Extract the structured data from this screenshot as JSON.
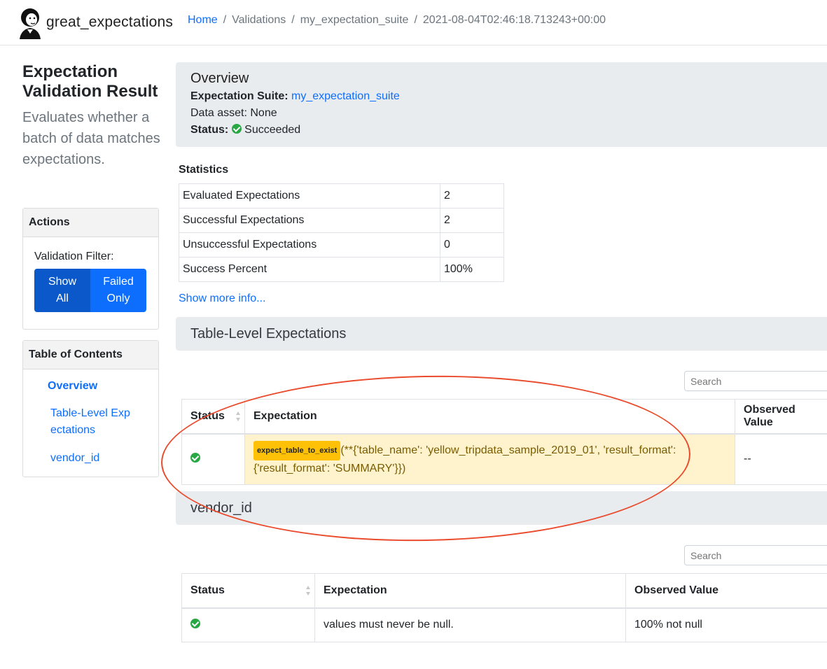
{
  "navbar": {
    "brand": "great_expectations",
    "breadcrumb": {
      "home": "Home",
      "validations": "Validations",
      "suite": "my_expectation_suite",
      "run": "2021-08-04T02:46:18.713243+00:00"
    }
  },
  "sidebar": {
    "title": "Expectation Validation Result",
    "description": "Evaluates whether a batch of data matches expectations.",
    "actions": {
      "header": "Actions",
      "filter_label": "Validation Filter:",
      "show_all": "Show All",
      "failed_only": "Failed Only"
    },
    "toc": {
      "header": "Table of Contents",
      "items": [
        "Overview",
        "Table-Level Exp ectations",
        "vendor_id"
      ]
    }
  },
  "overview": {
    "title": "Overview",
    "suite_label": "Expectation Suite:",
    "suite_value": "my_expectation_suite",
    "data_asset": "Data asset: None",
    "status_label": "Status:",
    "status_value": "Succeeded"
  },
  "statistics": {
    "title": "Statistics",
    "rows": [
      {
        "label": "Evaluated Expectations",
        "value": "2"
      },
      {
        "label": "Successful Expectations",
        "value": "2"
      },
      {
        "label": "Unsuccessful Expectations",
        "value": "0"
      },
      {
        "label": "Success Percent",
        "value": "100%"
      }
    ],
    "more_link": "Show more info..."
  },
  "table_level": {
    "title": "Table-Level Expectations",
    "search_placeholder": "Search",
    "headers": {
      "status": "Status",
      "expectation": "Expectation",
      "observed": "Observed Value"
    },
    "rows": [
      {
        "expectation_type": "expect_table_to_exist",
        "kwargs": "(**{'table_name': 'yellow_tripdata_sample_2019_01', 'result_format': {'result_format': 'SUMMARY'}})",
        "observed": "--"
      }
    ]
  },
  "vendor_id": {
    "title": "vendor_id",
    "search_placeholder": "Search",
    "headers": {
      "status": "Status",
      "expectation": "Expectation",
      "observed": "Observed Value"
    },
    "rows": [
      {
        "expectation": "values must never be null.",
        "observed": "100% not null"
      }
    ]
  },
  "colors": {
    "accent": "#0d6efd",
    "success": "#28a745",
    "highlight_ring": "#ea4b2c",
    "warning_bg": "#fff3cd"
  }
}
